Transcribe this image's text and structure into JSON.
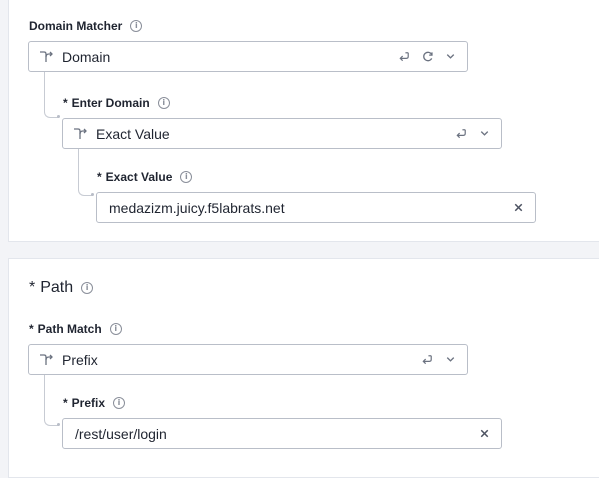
{
  "domain_section": {
    "domain_matcher": {
      "label": "Domain Matcher",
      "info_icon": "info-icon",
      "selected": "Domain",
      "icons": [
        "route-icon",
        "return-icon",
        "refresh-icon",
        "chevron-down-icon"
      ]
    },
    "enter_domain": {
      "required_mark": "*",
      "label": "Enter Domain",
      "selected": "Exact Value",
      "icons": [
        "route-icon",
        "return-icon",
        "chevron-down-icon"
      ]
    },
    "exact_value": {
      "required_mark": "*",
      "label": "Exact Value",
      "value": "medazizm.juicy.f5labrats.net",
      "clear_icon": "close-icon"
    }
  },
  "path_section": {
    "title_required": "*",
    "title": "Path",
    "path_match": {
      "required_mark": "*",
      "label": "Path Match",
      "selected": "Prefix",
      "icons": [
        "route-icon",
        "return-icon",
        "chevron-down-icon"
      ]
    },
    "prefix": {
      "required_mark": "*",
      "label": "Prefix",
      "value": "/rest/user/login",
      "clear_icon": "close-icon"
    }
  },
  "colors": {
    "background": "#f3f4f7",
    "card": "#ffffff",
    "border": "#b9bec8",
    "icon": "#6b7280",
    "text": "#1f2430"
  }
}
